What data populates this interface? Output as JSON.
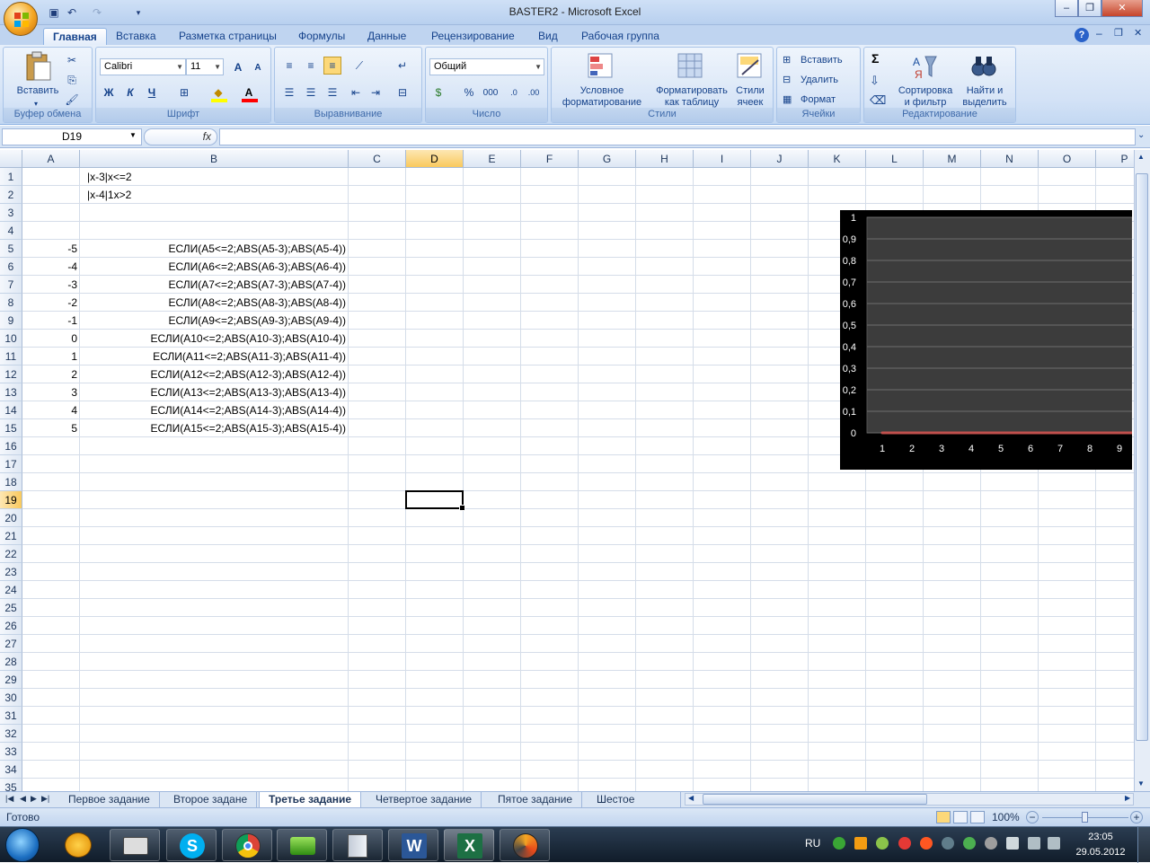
{
  "app": {
    "title": "BASTER2 - Microsoft Excel"
  },
  "ribbon_tabs": [
    {
      "label": "Главная",
      "active": true
    },
    {
      "label": "Вставка"
    },
    {
      "label": "Разметка страницы"
    },
    {
      "label": "Формулы"
    },
    {
      "label": "Данные"
    },
    {
      "label": "Рецензирование"
    },
    {
      "label": "Вид"
    },
    {
      "label": "Рабочая группа"
    }
  ],
  "ribbon": {
    "clipboard": {
      "label": "Буфер обмена",
      "paste": "Вставить"
    },
    "font": {
      "label": "Шрифт",
      "name": "Calibri",
      "size": "11",
      "bold": "Ж",
      "italic": "К",
      "underline": "Ч"
    },
    "alignment": {
      "label": "Выравнивание"
    },
    "number": {
      "label": "Число",
      "format": "Общий",
      "percent": "%",
      "thousands": "000"
    },
    "styles": {
      "label": "Стили",
      "conditional": "Условное\nформатирование",
      "as_table": "Форматировать\nкак таблицу",
      "cell_styles": "Стили\nячеек"
    },
    "cells": {
      "label": "Ячейки",
      "insert": "Вставить",
      "delete": "Удалить",
      "format": "Формат"
    },
    "editing": {
      "label": "Редактирование",
      "sort": "Сортировка\nи фильтр",
      "find": "Найти и\nвыделить",
      "sigma": "Σ"
    }
  },
  "formula_bar": {
    "name_box": "D19",
    "fx": "fx",
    "formula": ""
  },
  "columns": [
    "A",
    "B",
    "C",
    "D",
    "E",
    "F",
    "G",
    "H",
    "I",
    "J",
    "K",
    "L",
    "M",
    "N",
    "O",
    "P"
  ],
  "selected_column": "D",
  "selected_row": "19",
  "rows": [
    "1",
    "2",
    "3",
    "4",
    "5",
    "6",
    "7",
    "8",
    "9",
    "10",
    "11",
    "12",
    "13",
    "14",
    "15",
    "16",
    "17",
    "18",
    "19",
    "20",
    "21",
    "22",
    "23",
    "24",
    "25",
    "26",
    "27",
    "28",
    "29",
    "30",
    "31",
    "32",
    "33",
    "34",
    "35"
  ],
  "cells": [
    {
      "row": 1,
      "col": "B",
      "value": "|x-3|x<=2",
      "align": "left"
    },
    {
      "row": 2,
      "col": "B",
      "value": "|x-4|1x>2",
      "align": "left"
    },
    {
      "row": 5,
      "col": "A",
      "value": "-5",
      "align": "right"
    },
    {
      "row": 5,
      "col": "B",
      "value": "ЕСЛИ(A5<=2;ABS(A5-3);ABS(A5-4))",
      "align": "right"
    },
    {
      "row": 6,
      "col": "A",
      "value": "-4",
      "align": "right"
    },
    {
      "row": 6,
      "col": "B",
      "value": "ЕСЛИ(A6<=2;ABS(A6-3);ABS(A6-4))",
      "align": "right"
    },
    {
      "row": 7,
      "col": "A",
      "value": "-3",
      "align": "right"
    },
    {
      "row": 7,
      "col": "B",
      "value": "ЕСЛИ(A7<=2;ABS(A7-3);ABS(A7-4))",
      "align": "right"
    },
    {
      "row": 8,
      "col": "A",
      "value": "-2",
      "align": "right"
    },
    {
      "row": 8,
      "col": "B",
      "value": "ЕСЛИ(A8<=2;ABS(A8-3);ABS(A8-4))",
      "align": "right"
    },
    {
      "row": 9,
      "col": "A",
      "value": "-1",
      "align": "right"
    },
    {
      "row": 9,
      "col": "B",
      "value": "ЕСЛИ(A9<=2;ABS(A9-3);ABS(A9-4))",
      "align": "right"
    },
    {
      "row": 10,
      "col": "A",
      "value": "0",
      "align": "right"
    },
    {
      "row": 10,
      "col": "B",
      "value": "ЕСЛИ(A10<=2;ABS(A10-3);ABS(A10-4))",
      "align": "right"
    },
    {
      "row": 11,
      "col": "A",
      "value": "1",
      "align": "right"
    },
    {
      "row": 11,
      "col": "B",
      "value": "ЕСЛИ(A11<=2;ABS(A11-3);ABS(A11-4))",
      "align": "right"
    },
    {
      "row": 12,
      "col": "A",
      "value": "2",
      "align": "right"
    },
    {
      "row": 12,
      "col": "B",
      "value": "ЕСЛИ(A12<=2;ABS(A12-3);ABS(A12-4))",
      "align": "right"
    },
    {
      "row": 13,
      "col": "A",
      "value": "3",
      "align": "right"
    },
    {
      "row": 13,
      "col": "B",
      "value": "ЕСЛИ(A13<=2;ABS(A13-3);ABS(A13-4))",
      "align": "right"
    },
    {
      "row": 14,
      "col": "A",
      "value": "4",
      "align": "right"
    },
    {
      "row": 14,
      "col": "B",
      "value": "ЕСЛИ(A14<=2;ABS(A14-3);ABS(A14-4))",
      "align": "right"
    },
    {
      "row": 15,
      "col": "A",
      "value": "5",
      "align": "right"
    },
    {
      "row": 15,
      "col": "B",
      "value": "ЕСЛИ(A15<=2;ABS(A15-3);ABS(A15-4))",
      "align": "right"
    }
  ],
  "chart_data": {
    "type": "line",
    "categories": [
      "1",
      "2",
      "3",
      "4",
      "5",
      "6",
      "7",
      "8",
      "9"
    ],
    "series": [
      {
        "values": [
          0,
          0,
          0,
          0,
          0,
          0,
          0,
          0,
          0
        ],
        "color": "#c0504d"
      }
    ],
    "y_ticks": [
      "0",
      "0,1",
      "0,2",
      "0,3",
      "0,4",
      "0,5",
      "0,6",
      "0,7",
      "0,8",
      "0,9",
      "1"
    ],
    "ylim": [
      0,
      1
    ],
    "grid": true,
    "background": "#3c3c3c"
  },
  "sheet_tabs": [
    {
      "label": "Первое задание"
    },
    {
      "label": "Второе задане"
    },
    {
      "label": "Третье задание",
      "active": true
    },
    {
      "label": "Четвертое задание"
    },
    {
      "label": "Пятое задание"
    },
    {
      "label": "Шестое задание"
    }
  ],
  "status": {
    "ready": "Готово",
    "zoom": "100%"
  },
  "taskbar": {
    "lang": "RU",
    "time": "23:05",
    "date": "29.05.2012",
    "apps": [
      "start-orb",
      "aimp",
      "printer",
      "skype",
      "chrome",
      "utility",
      "archive",
      "word",
      "excel",
      "winamp"
    ]
  },
  "colors": {
    "accent": "#15428b",
    "selected_header": "#f9c95d",
    "chart_bg": "#000000",
    "series_line": "#c0504d"
  }
}
